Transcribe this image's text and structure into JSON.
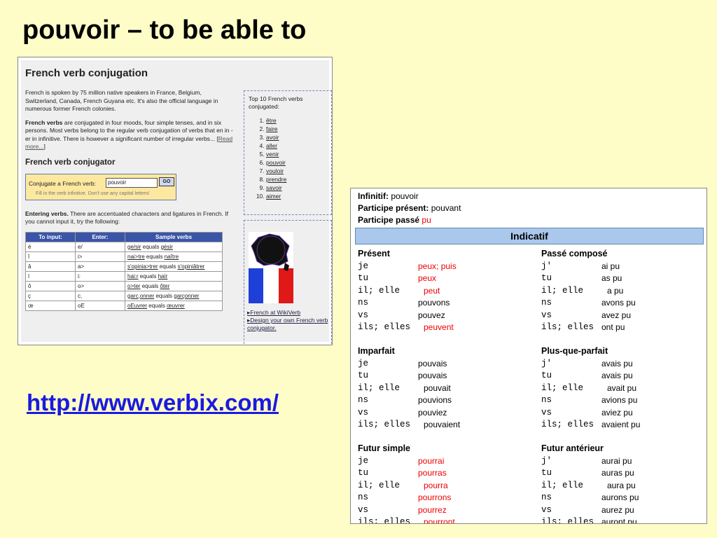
{
  "slide": {
    "title": "pouvoir – to be able to",
    "link": "http://www.verbix.com/"
  },
  "verbix": {
    "heading": "French verb conjugation",
    "intro_p1": "French is spoken by 75 million native speakers in France, Belgium, Switzerland, Canada, French Guyana etc. It's also the official language in numerous former French colonies.",
    "intro_p2_bold": "French verbs",
    "intro_p2": " are conjugated in four moods, four simple tenses, and in six persons. Most verbs belong to the regular verb conjugation of verbs that en in -er in infinitive. There is however a significant number of irregular verbs... [",
    "read_more": "Read more...",
    "read_more_close": "]",
    "conjugator_heading": "French verb conjugator",
    "conjugate_label": "Conjugate a French verb:",
    "conjugate_value": "pouvoir",
    "go_label": "GO",
    "hint": "Fill in the verb infinitive. Don't use any capital letters!",
    "entering_bold": "Entering verbs.",
    "entering_text": " There are accentuated characters and ligatures in French. If you cannot input it, try the following:",
    "table_headers": [
      "To input:",
      "Enter:",
      "Sample verbs"
    ],
    "table_rows": [
      {
        "input": "é",
        "enter": "e/",
        "sample_a": "ge/sir",
        "equals": " equals ",
        "sample_b": "gésir"
      },
      {
        "input": "î",
        "enter": "i>",
        "sample_a": "nai>tre",
        "equals": " equals ",
        "sample_b": "naître"
      },
      {
        "input": "â",
        "enter": "a>",
        "sample_a": "s'opinia>trer",
        "equals": " equals ",
        "sample_b": "s'opiniâtrer"
      },
      {
        "input": "ï",
        "enter": "i:",
        "sample_a": "hai:r",
        "equals": " equals ",
        "sample_b": "haïr"
      },
      {
        "input": "ô",
        "enter": "o>",
        "sample_a": "o>ter",
        "equals": " equals ",
        "sample_b": "ôter"
      },
      {
        "input": "ç",
        "enter": "c,",
        "sample_a": "garc,onner",
        "equals": " equals ",
        "sample_b": "garçonner"
      },
      {
        "input": "œ",
        "enter": "oE",
        "sample_a": "oEuvrer",
        "equals": " equals ",
        "sample_b": "œuvrer"
      }
    ],
    "top10_title": "Top 10 French verbs conjugated:",
    "top10": [
      "être",
      "faire",
      "avoir",
      "aller",
      "venir",
      "pouvoir",
      "vouloir",
      "prendre",
      "savoir",
      "aimer"
    ],
    "side_link1": "French at WikiVerb",
    "side_link2": "Design your own French verb conjugator."
  },
  "conjugation": {
    "infinitif_label": "Infinitif:",
    "infinitif_value": "pouvoir",
    "part_present_label": "Participe présent:",
    "part_present_value": "pouvant",
    "part_passe_label": "Participe passé",
    "part_passe_value": "pu",
    "mood": "Indicatif",
    "pronouns": [
      "je",
      "tu",
      "il; elle",
      "ns",
      "vs",
      "ils; elles"
    ],
    "pronouns_compound": [
      "j'",
      "tu",
      "il; elle",
      "ns",
      "vs",
      "ils; elles"
    ],
    "present": {
      "title": "Présent",
      "forms": [
        "peux; puis",
        "peux",
        "peut",
        "pouvons",
        "pouvez",
        "peuvent"
      ]
    },
    "passe_compose": {
      "title": "Passé composé",
      "forms": [
        "ai pu",
        "as pu",
        "a pu",
        "avons pu",
        "avez pu",
        "ont pu"
      ]
    },
    "imparfait": {
      "title": "Imparfait",
      "forms": [
        "pouvais",
        "pouvais",
        "pouvait",
        "pouvions",
        "pouviez",
        "pouvaient"
      ]
    },
    "plus_que_parfait": {
      "title": "Plus-que-parfait",
      "forms": [
        "avais pu",
        "avais pu",
        "avait pu",
        "avions pu",
        "aviez pu",
        "avaient pu"
      ]
    },
    "futur_simple": {
      "title": "Futur simple",
      "forms": [
        "pourrai",
        "pourras",
        "pourra",
        "pourrons",
        "pourrez",
        "pourront"
      ]
    },
    "futur_anterieur": {
      "title": "Futur antérieur",
      "forms": [
        "aurai pu",
        "auras pu",
        "aura pu",
        "aurons pu",
        "aurez pu",
        "auront pu"
      ]
    }
  }
}
